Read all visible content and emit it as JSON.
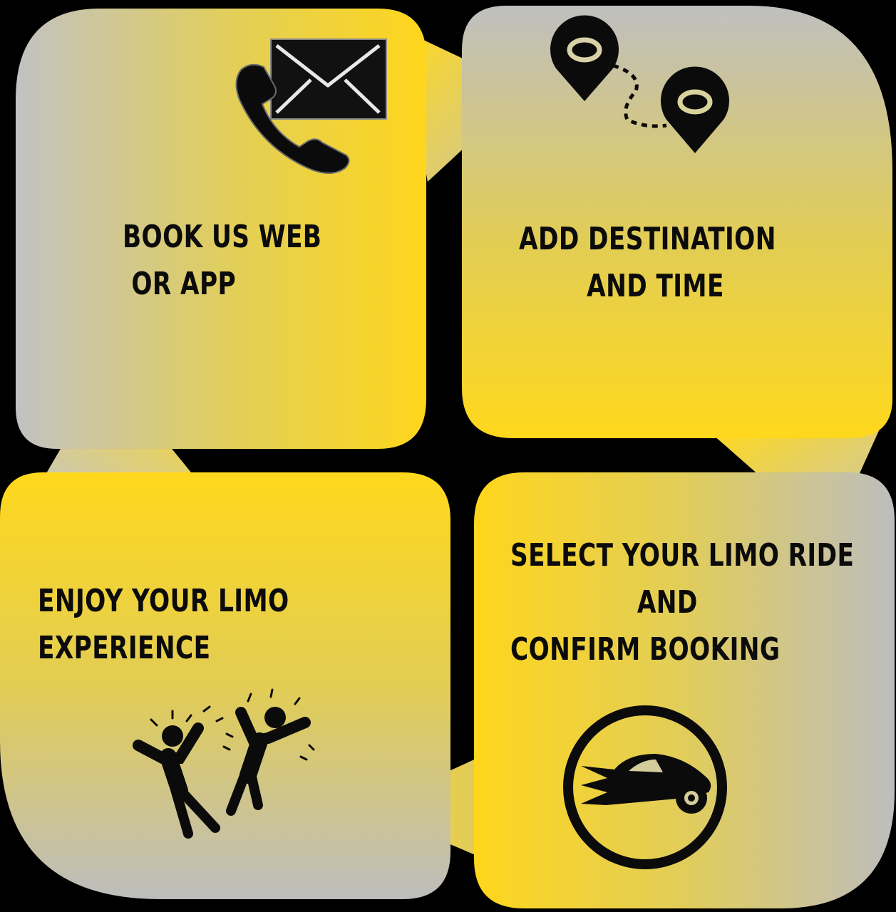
{
  "steps": [
    {
      "lines": [
        "BOOK US WEB",
        " OR APP"
      ],
      "icon": "phone-mail-icon"
    },
    {
      "lines": [
        "ADD DESTINATION",
        "AND TIME"
      ],
      "icon": "route-pins-icon"
    },
    {
      "lines": [
        "SELECT YOUR LIMO RIDE",
        "AND",
        "CONFIRM BOOKING"
      ],
      "icon": "car-circle-icon"
    },
    {
      "lines": [
        "ENJOY YOUR LIMO",
        "EXPERIENCE"
      ],
      "icon": "celebrating-people-icon"
    }
  ],
  "colors": {
    "background": "#000000",
    "yellow": "#ffd820",
    "grey": "#bdbdbd",
    "ink": "#0b0b0b"
  }
}
